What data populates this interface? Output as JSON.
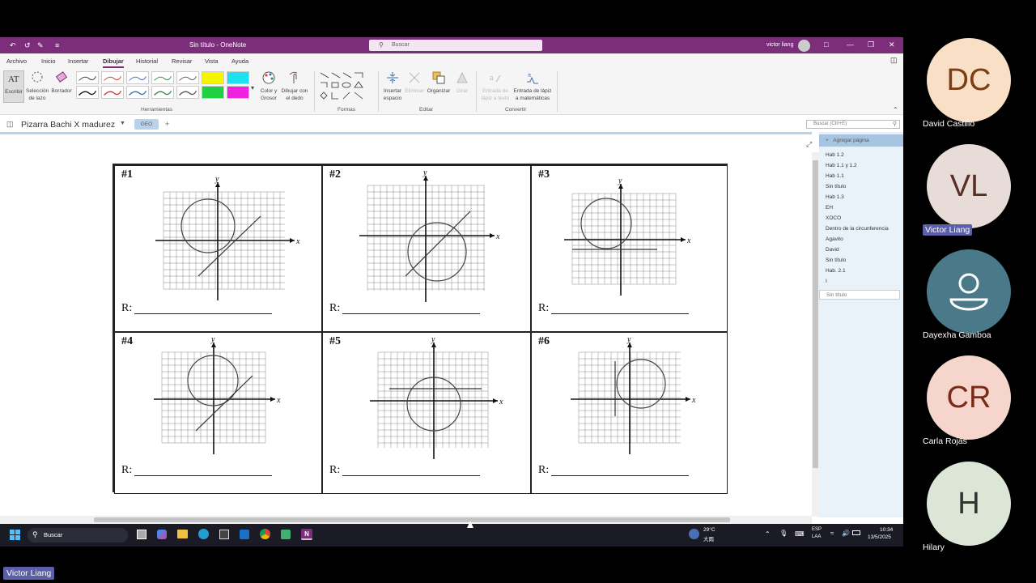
{
  "window": {
    "title": "Sin título  -  OneNote",
    "search_placeholder": "Buscar",
    "user": "victor liang"
  },
  "menu": [
    "Archivo",
    "Inicio",
    "Insertar",
    "Dibujar",
    "Historial",
    "Revisar",
    "Vista",
    "Ayuda"
  ],
  "ribbon": {
    "escribir": "Escribir",
    "lazo": "Selección de lazo",
    "borrador": "Borrador",
    "color": "Color y Grosor",
    "dedo": "Dibujar con el dedo",
    "herramientas": "Herramientas",
    "formas": "Formas",
    "insertar_espacio": "Insertar espacio",
    "eliminar": "Eliminar",
    "organizar": "Organizar",
    "girar": "Girar",
    "editar": "Editar",
    "lapiz_texto": "Entrada de lápiz a texto",
    "lapiz_mat": "Entrada de lápiz a matemáticas",
    "convertir": "Convertir"
  },
  "notebook": {
    "name": "Pizarra Bachi X madurez",
    "section": "GEO",
    "add": "+",
    "search": "Buscar (Ctrl+E)"
  },
  "pages": {
    "add_label": "Agregar página",
    "items": [
      "Hab 1.2",
      "Hab 1.1 y 1.2",
      "Hab 1.1",
      "Sin título",
      "Hab 1.3",
      "EH",
      "XOCO",
      "Dentro de la circunferencia",
      "Agavito",
      "David",
      "Sin título",
      "Hab. 2.1",
      "I"
    ],
    "selected": "Sin título"
  },
  "worksheet": {
    "cells": [
      {
        "num": "#1",
        "answer": "R:"
      },
      {
        "num": "#2",
        "answer": "R:"
      },
      {
        "num": "#3",
        "answer": "R:"
      },
      {
        "num": "#4",
        "answer": "R:"
      },
      {
        "num": "#5",
        "answer": "R:"
      },
      {
        "num": "#6",
        "answer": "R:"
      }
    ],
    "xlabel": "x",
    "ylabel": "y"
  },
  "taskbar": {
    "search": "Buscar",
    "weather_temp": "29°C",
    "weather_desc": "大雨",
    "lang1": "ESP",
    "lang2": "LAA",
    "time": "10:34",
    "date": "13/5/2025"
  },
  "participants": [
    {
      "initials": "DC",
      "name": "David Castillo",
      "bg": "#f9dfc6",
      "fg": "#7a3e12"
    },
    {
      "initials": "VL",
      "name": "Victor Liang",
      "bg": "#e8dcd8",
      "fg": "#5a2e24"
    },
    {
      "initials": "",
      "name": "Dayexha Gamboa",
      "bg": "#4a7a8a",
      "fg": "#ffffff"
    },
    {
      "initials": "CR",
      "name": "Carla Rojas",
      "bg": "#f6d6cc",
      "fg": "#7a2a18"
    },
    {
      "initials": "H",
      "name": "Hilary",
      "bg": "#dce6d6",
      "fg": "#333333"
    }
  ],
  "speaker_label": "Victor Liang"
}
